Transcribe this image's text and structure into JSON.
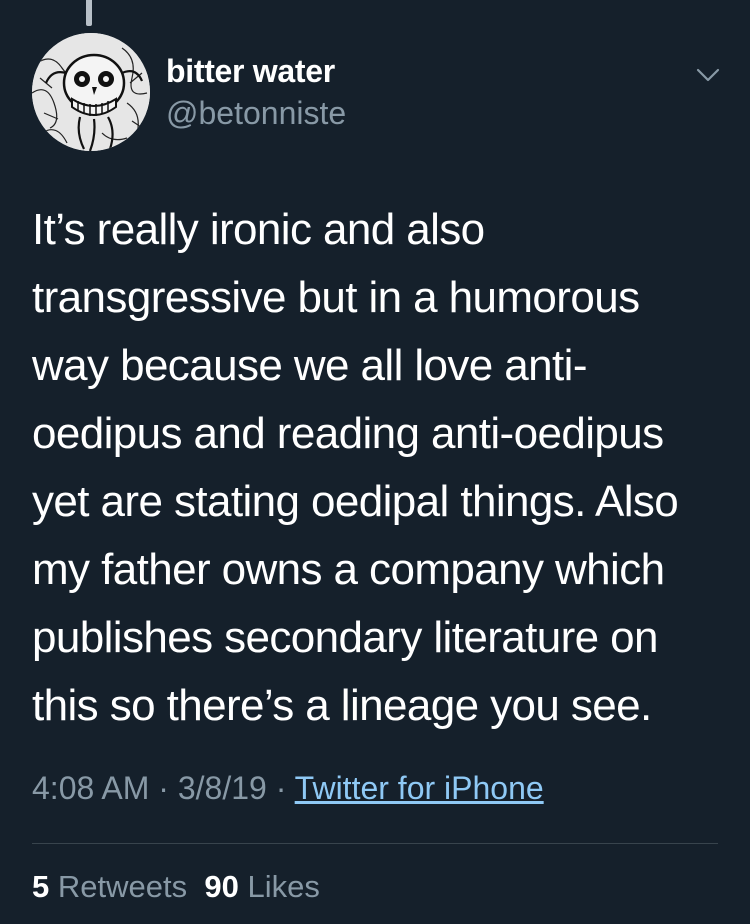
{
  "user": {
    "display_name": "bitter water",
    "handle": "@betonniste",
    "avatar_icon": "skull-illustration-avatar"
  },
  "tweet": {
    "lines": [
      "It’s really ironic and also",
      "transgressive but in a humorous",
      "way because we all love anti-",
      "oedipus and reading anti-oedipus",
      "yet are stating oedipal things. Also",
      "my father owns a company which",
      "publishes secondary literature on",
      "this so there’s a lineage you see."
    ]
  },
  "meta": {
    "time": "4:08 AM",
    "sep1": " · ",
    "date": "3/8/19",
    "sep2": " · ",
    "source": "Twitter for iPhone"
  },
  "stats": {
    "retweets_count": "5",
    "retweets_label": "Retweets",
    "likes_count": "90",
    "likes_label": "Likes"
  },
  "colors": {
    "background": "#15202b",
    "text": "#ffffff",
    "secondary": "#8899a6",
    "link": "#8fc9f5",
    "divider": "#38444d"
  },
  "icons": {
    "menu": "chevron-down-icon"
  }
}
